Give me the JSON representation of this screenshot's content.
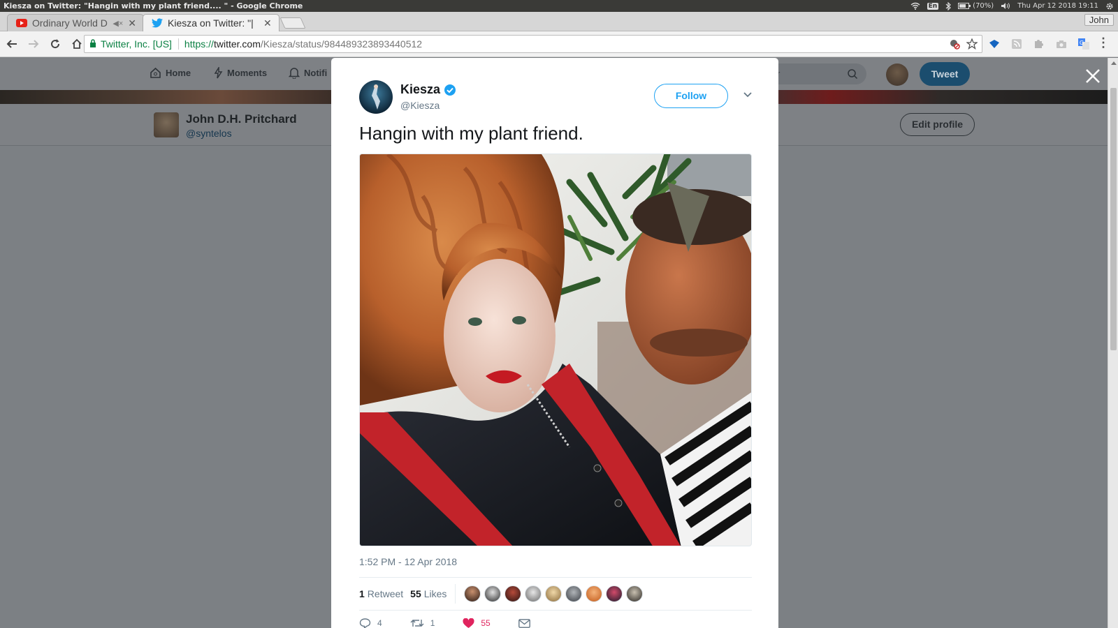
{
  "os": {
    "window_title": "Kiesza on Twitter: \"Hangin with my plant friend.... \" - Google Chrome",
    "lang": "En",
    "battery": "(70%)",
    "clock": "Thu Apr 12 2018 19:11"
  },
  "browser": {
    "tabs": [
      {
        "title": "Ordinary World D",
        "favicon": "youtube-icon"
      },
      {
        "title": "Kiesza on Twitter: \"|",
        "favicon": "twitter-icon"
      }
    ],
    "profile_name": "John",
    "omnibox": {
      "ev_label": "Twitter, Inc. [US]",
      "url_scheme": "https://",
      "url_host": "twitter.com",
      "url_path": "/Kiesza/status/984489323893440512"
    }
  },
  "twitter_page": {
    "nav": {
      "home": "Home",
      "moments": "Moments",
      "notifications": "Notifi",
      "search_placeholder": "r",
      "tweet_button": "Tweet"
    },
    "profile": {
      "name": "John D.H. Pritchard",
      "handle": "@syntelos",
      "edit_button": "Edit profile"
    }
  },
  "tweet": {
    "author_name": "Kiesza",
    "author_handle": "@Kiesza",
    "verified": true,
    "follow_label": "Follow",
    "text": "Hangin with my plant friend.",
    "timestamp": "1:52 PM - 12 Apr 2018",
    "retweets_count": "1",
    "retweets_label": "Retweet",
    "likes_count": "55",
    "likes_label": "Likes",
    "likers_count_shown": 9,
    "actions": {
      "replies": "4",
      "retweets": "1",
      "likes": "55"
    }
  },
  "colors": {
    "twitter_blue": "#1da1f2",
    "like_red": "#e0245e",
    "text_primary": "#14171a",
    "text_secondary": "#657786"
  }
}
